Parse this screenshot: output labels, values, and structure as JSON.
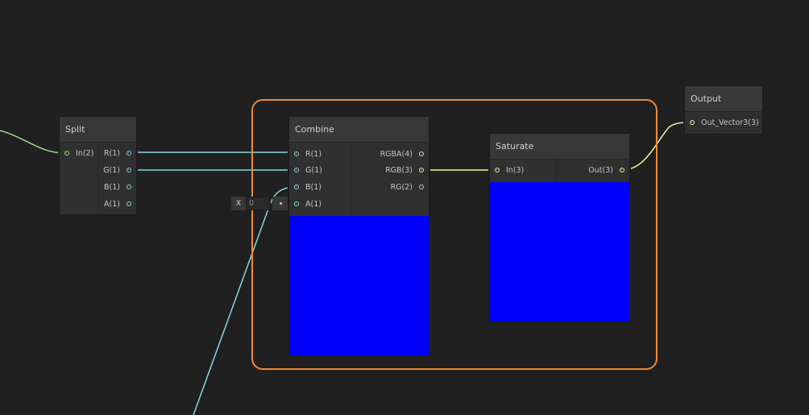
{
  "nodes": {
    "split": {
      "title": "Split",
      "inputs": [
        "In(2)"
      ],
      "outputs": [
        "R(1)",
        "G(1)",
        "B(1)",
        "A(1)"
      ]
    },
    "combine": {
      "title": "Combine",
      "inputs": [
        "R(1)",
        "G(1)",
        "B(1)",
        "A(1)"
      ],
      "outputs": [
        "RGBA(4)",
        "RGB(3)",
        "RG(2)"
      ],
      "preview_color": "#0000ff"
    },
    "saturate": {
      "title": "Saturate",
      "inputs": [
        "In(3)"
      ],
      "outputs": [
        "Out(3)"
      ],
      "preview_color": "#0000ff"
    },
    "output": {
      "title": "Output",
      "inputs": [
        "Out_Vector3(3)"
      ]
    }
  },
  "inline_field": {
    "label": "X",
    "value": "0"
  },
  "colors": {
    "group_border": "#f08a3a",
    "wire_float": "#8ad6e8",
    "wire_vector2": "#9bdd8a",
    "wire_vector3": "#f2f29a",
    "background": "#202020"
  }
}
